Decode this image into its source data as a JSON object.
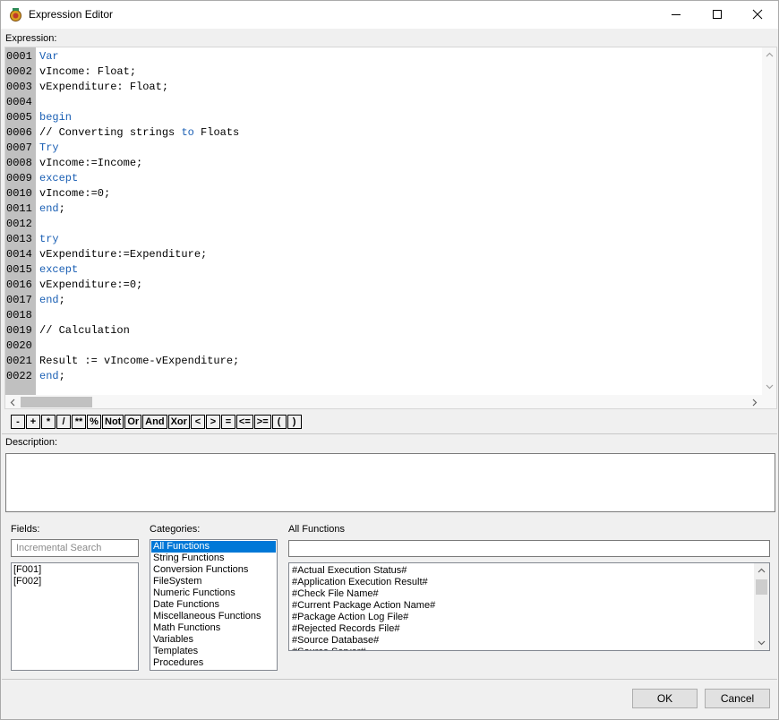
{
  "window": {
    "title": "Expression Editor"
  },
  "labels": {
    "expression": "Expression:",
    "description": "Description:",
    "fields": "Fields:",
    "categories": "Categories:",
    "all_functions": "All Functions"
  },
  "editor": {
    "lines": [
      {
        "num": "0001",
        "segments": [
          {
            "t": "Var",
            "k": "kw"
          }
        ]
      },
      {
        "num": "0002",
        "segments": [
          {
            "t": "vIncome: Float;",
            "k": ""
          }
        ]
      },
      {
        "num": "0003",
        "segments": [
          {
            "t": "vExpenditure: Float;",
            "k": ""
          }
        ]
      },
      {
        "num": "0004",
        "segments": []
      },
      {
        "num": "0005",
        "segments": [
          {
            "t": "begin",
            "k": "kw"
          }
        ]
      },
      {
        "num": "0006",
        "segments": [
          {
            "t": "// Converting strings ",
            "k": ""
          },
          {
            "t": "to",
            "k": "kw"
          },
          {
            "t": " Floats",
            "k": ""
          }
        ]
      },
      {
        "num": "0007",
        "segments": [
          {
            "t": "Try",
            "k": "kw"
          }
        ]
      },
      {
        "num": "0008",
        "segments": [
          {
            "t": "vIncome:=Income;",
            "k": ""
          }
        ]
      },
      {
        "num": "0009",
        "segments": [
          {
            "t": "except",
            "k": "kw"
          }
        ]
      },
      {
        "num": "0010",
        "segments": [
          {
            "t": "vIncome:=0;",
            "k": ""
          }
        ]
      },
      {
        "num": "0011",
        "segments": [
          {
            "t": "end",
            "k": "kw"
          },
          {
            "t": ";",
            "k": ""
          }
        ]
      },
      {
        "num": "0012",
        "segments": []
      },
      {
        "num": "0013",
        "segments": [
          {
            "t": "try",
            "k": "kw"
          }
        ]
      },
      {
        "num": "0014",
        "segments": [
          {
            "t": "vExpenditure:=Expenditure;",
            "k": ""
          }
        ]
      },
      {
        "num": "0015",
        "segments": [
          {
            "t": "except",
            "k": "kw"
          }
        ]
      },
      {
        "num": "0016",
        "segments": [
          {
            "t": "vExpenditure:=0;",
            "k": ""
          }
        ]
      },
      {
        "num": "0017",
        "segments": [
          {
            "t": "end",
            "k": "kw"
          },
          {
            "t": ";",
            "k": ""
          }
        ]
      },
      {
        "num": "0018",
        "segments": []
      },
      {
        "num": "0019",
        "segments": [
          {
            "t": "// Calculation",
            "k": ""
          }
        ]
      },
      {
        "num": "0020",
        "segments": []
      },
      {
        "num": "0021",
        "segments": [
          {
            "t": "Result := vIncome-vExpenditure;",
            "k": ""
          }
        ]
      },
      {
        "num": "0022",
        "segments": [
          {
            "t": "end",
            "k": "kw"
          },
          {
            "t": ";",
            "k": ""
          }
        ]
      }
    ]
  },
  "operators": [
    "-",
    "+",
    "*",
    "/",
    "**",
    "%",
    "Not",
    "Or",
    "And",
    "Xor",
    "<",
    ">",
    "=",
    "<=",
    ">=",
    "(",
    ")"
  ],
  "fields": {
    "search_placeholder": "Incremental Search",
    "items": [
      "[F001]",
      "[F002]"
    ]
  },
  "categories": {
    "selected": "All Functions",
    "items": [
      "All Functions",
      "String Functions",
      "Conversion Functions",
      "FileSystem",
      "Numeric Functions",
      "Date Functions",
      "Miscellaneous Functions",
      "Math Functions",
      "Variables",
      "Templates",
      "Procedures"
    ]
  },
  "functions": {
    "filter_value": "",
    "items": [
      "#Actual Execution Status#",
      "#Application Execution Result#",
      "#Check File Name#",
      "#Current Package Action Name#",
      "#Package Action Log File#",
      "#Rejected Records File#",
      "#Source Database#",
      "#Source Server#"
    ]
  },
  "buttons": {
    "ok": "OK",
    "cancel": "Cancel"
  },
  "colors": {
    "keyword": "#1a5fb4",
    "selection": "#0078d7",
    "gutter": "#c0c0c0"
  }
}
